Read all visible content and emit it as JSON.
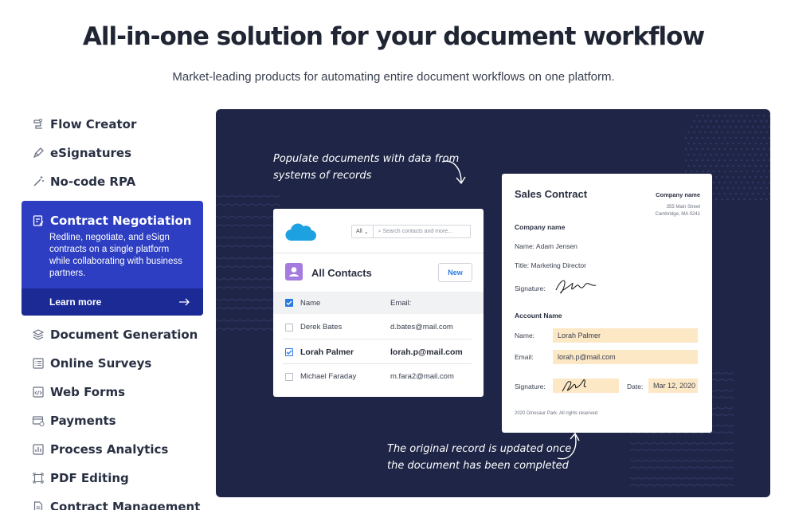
{
  "header": {
    "title": "All-in-one solution for your document workflow",
    "subtitle": "Market-leading products for automating entire document workflows on one platform."
  },
  "nav": {
    "items": [
      {
        "label": "Flow Creator",
        "icon": "flow-icon"
      },
      {
        "label": "eSignatures",
        "icon": "pen-icon"
      },
      {
        "label": "No-code RPA",
        "icon": "wand-icon"
      },
      {
        "label": "Contract Negotiation",
        "icon": "contract-icon",
        "active": true,
        "description": "Redline, negotiate, and eSign contracts on a single platform while collaborating with business partners.",
        "cta": "Learn more"
      },
      {
        "label": "Document Generation",
        "icon": "layers-icon"
      },
      {
        "label": "Online Surveys",
        "icon": "survey-icon"
      },
      {
        "label": "Web Forms",
        "icon": "code-window-icon"
      },
      {
        "label": "Payments",
        "icon": "payment-icon"
      },
      {
        "label": "Process Analytics",
        "icon": "chart-icon"
      },
      {
        "label": "PDF Editing",
        "icon": "pdf-edit-icon"
      },
      {
        "label": "Contract Management",
        "icon": "document-icon"
      }
    ],
    "accent": "#2d3ec2"
  },
  "hero": {
    "note_top": [
      "Populate documents with data from",
      "systems of records"
    ],
    "note_bottom": [
      "The original record is updated once",
      "the document has been completed"
    ],
    "background": "#1e2546",
    "contacts": {
      "search_scope": "All",
      "search_placeholder": "Search contacts and more...",
      "title": "All Contacts",
      "new_label": "New",
      "col_name": "Name",
      "col_email": "Email:",
      "rows": [
        {
          "name": "Derek Bates",
          "email": "d.bates@mail.com",
          "checked": false
        },
        {
          "name": "Lorah Palmer",
          "email": "lorah.p@mail.com",
          "checked": true
        },
        {
          "name": "Michael Faraday",
          "email": "m.fara2@mail.com",
          "checked": false
        }
      ]
    },
    "contract": {
      "title": "Sales Contract",
      "company": "Company name",
      "address_line1": "355 Main Street",
      "address_line2": "Cambridge, MA 0241",
      "section1": "Company name",
      "name_line": "Name: Adam Jensen",
      "title_line": "Title: Marketing Director",
      "signature_label": "Signature:",
      "section2": "Account Name",
      "name_label": "Name:",
      "name_value": "Lorah Palmer",
      "email_label": "Email:",
      "email_value": "lorah.p@mail.com",
      "sig2_label": "Signature:",
      "date_label": "Date:",
      "date_value": "Mar 12, 2020",
      "footer": "2020 Dinosaur Park. All rights reserved",
      "highlight": "#fde8c6"
    }
  }
}
